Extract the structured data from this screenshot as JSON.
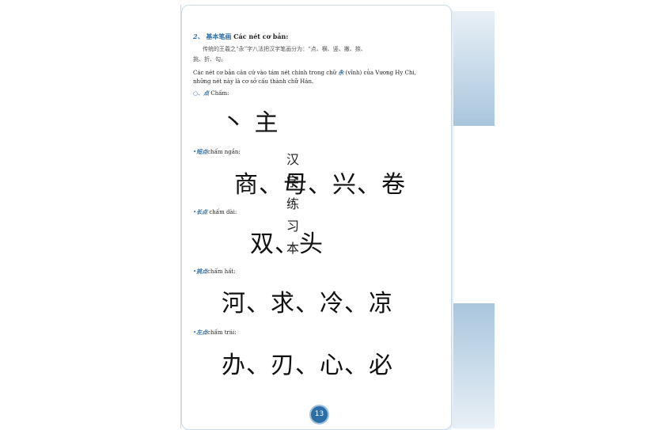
{
  "book_title": [
    "汉",
    "字",
    "练",
    "习",
    "本"
  ],
  "section": {
    "number": "2、",
    "title_cn": "基本笔画",
    "title_vi": "Các nét cơ bản:"
  },
  "intro_cn_1": "传统的王羲之“永”字八法把汉字笔画分为：“点、横、竖、撇、捺、",
  "intro_cn_2": "挑、折、勾。",
  "intro_vi_1_pre": "Các nét cơ bản căn cứ vào tám nét chính trong chữ ",
  "intro_vi_1_char": "永",
  "intro_vi_1_post": " (vĩnh) của Vương Hy Chi,",
  "intro_vi_2": "những nét này là cơ sở cấu thành chữ Hán.",
  "subsections": [
    {
      "marker": "○、",
      "cn": "点",
      "vi": "Chấm:",
      "example": "丶 主"
    },
    {
      "marker": "•",
      "cn": "短点",
      "vi": "chấm ngắn:",
      "example": "商、母、兴、卷"
    },
    {
      "marker": "•",
      "cn": "长点",
      "vi": "chấm dài:",
      "example": "双、头"
    },
    {
      "marker": "•",
      "cn": "挑点",
      "vi": "chấm hất:",
      "example": "河、求、冷、凉"
    },
    {
      "marker": "•",
      "cn": "左点",
      "vi": "chấm trái:",
      "example": "办、刃、心、必"
    }
  ],
  "page_number": "13"
}
